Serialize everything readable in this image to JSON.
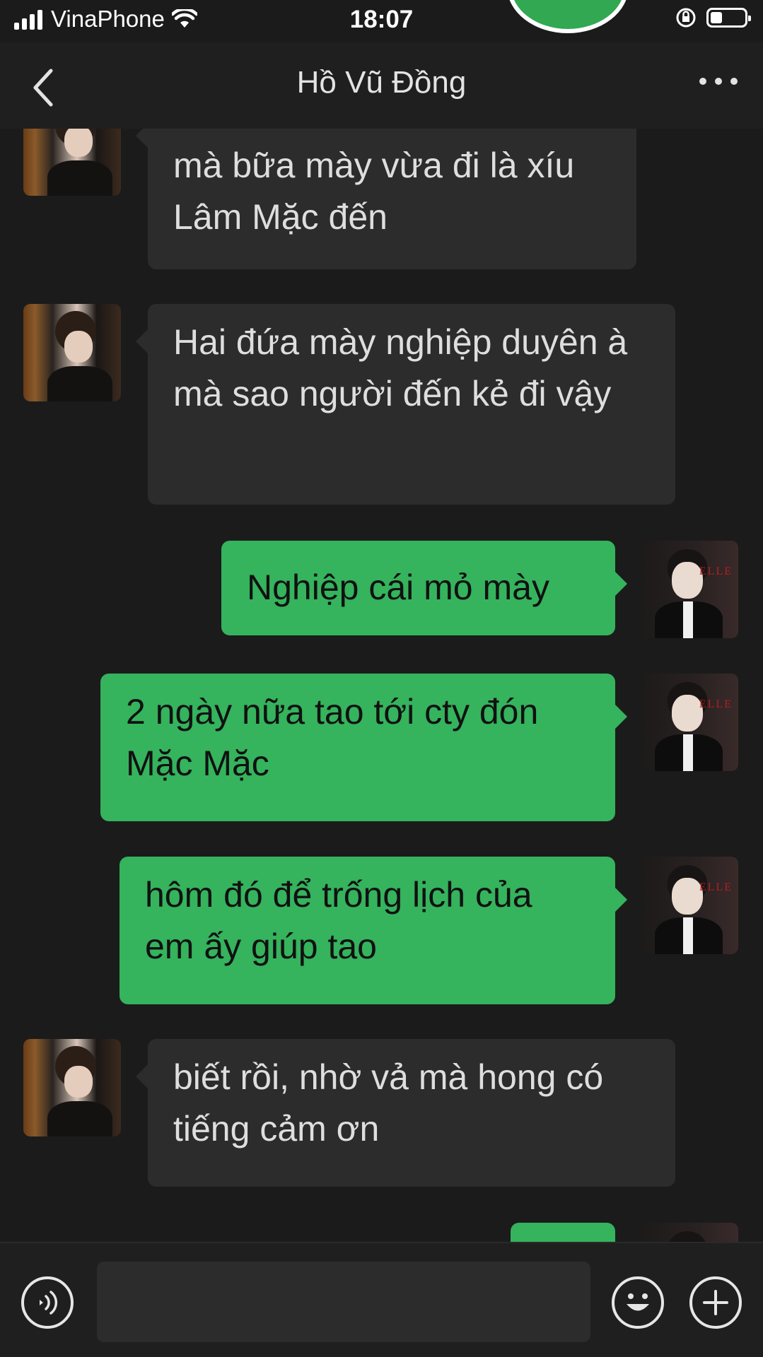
{
  "status_bar": {
    "carrier": "VinaPhone",
    "time": "18:07"
  },
  "header": {
    "title": "Hồ Vũ Đồng"
  },
  "messages": [
    {
      "side": "in",
      "text": "mà bữa mày vừa đi là xíu Lâm Mặc đến"
    },
    {
      "side": "in",
      "text": "Hai đứa mày nghiệp duyên à mà sao người đến kẻ đi vậy"
    },
    {
      "side": "out",
      "text": "Nghiệp cái mỏ mày"
    },
    {
      "side": "out",
      "text": "2 ngày nữa tao tới cty đón Mặc Mặc"
    },
    {
      "side": "out",
      "text": "hôm đó để trống lịch của em ấy giúp tao"
    },
    {
      "side": "in",
      "text": "biết rồi, nhờ vả mà hong có tiếng cảm ơn"
    }
  ],
  "input_bar": {
    "value": "",
    "placeholder": ""
  },
  "icons": [
    "signal-icon",
    "wifi-icon",
    "rotation-lock-icon",
    "battery-icon",
    "back-icon",
    "more-icon",
    "voice-icon",
    "emoji-icon",
    "plus-icon"
  ],
  "colors": {
    "background": "#1b1b1b",
    "incoming_bubble": "#2c2c2c",
    "outgoing_bubble": "#35b35d"
  }
}
